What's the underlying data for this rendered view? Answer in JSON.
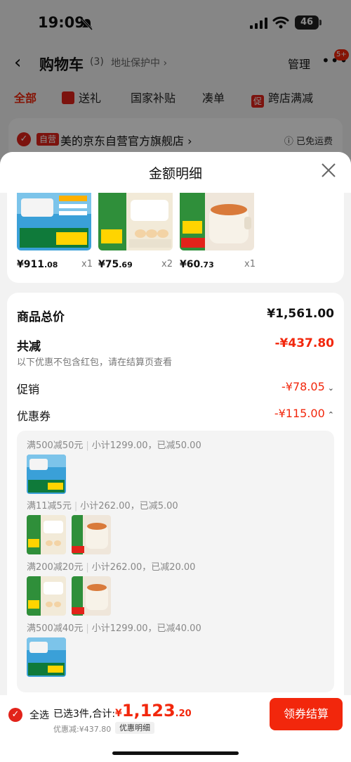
{
  "status_bar": {
    "time": "19:09",
    "battery": "46"
  },
  "nav": {
    "title": "购物车",
    "count": "(3)",
    "address_protect": "地址保护中 ›",
    "manage": "管理",
    "more_badge": "5+"
  },
  "tabs": [
    {
      "label": "全部"
    },
    {
      "label": "送礼"
    },
    {
      "label": "国家补贴"
    },
    {
      "label": "凑单"
    },
    {
      "label": "跨店满减",
      "badge": "促"
    }
  ],
  "store": {
    "tag": "自营",
    "name": "美的京东自营官方旗舰店 ›",
    "shipping": "已免运费"
  },
  "sheet": {
    "title": "金额明细",
    "goods": [
      {
        "price_int": "¥911",
        "price_dec": ".08",
        "qty": "x1"
      },
      {
        "price_int": "¥75",
        "price_dec": ".69",
        "qty": "x2"
      },
      {
        "price_int": "¥60",
        "price_dec": ".73",
        "qty": "x1"
      }
    ],
    "summary": {
      "total_label": "商品总价",
      "total_value": "¥1,561.00",
      "discount_label": "共减",
      "discount_value": "-¥437.80",
      "note": "以下优惠不包含红包，请在结算页查看",
      "promo_label": "促销",
      "promo_value": "-¥78.05",
      "coupon_label": "优惠券",
      "coupon_value": "-¥115.00"
    },
    "coupons": [
      {
        "rule": "满500减50元",
        "detail": "小计1299.00，已减50.00"
      },
      {
        "rule": "满11减5元",
        "detail": "小计262.00，已减5.00"
      },
      {
        "rule": "满200减20元",
        "detail": "小计262.00，已减20.00"
      },
      {
        "rule": "满500减40元",
        "detail": "小计1299.00，已减40.00"
      }
    ]
  },
  "bottom": {
    "select_all": "全选",
    "selected_info": "已选3件,合计:",
    "currency": "¥",
    "sum_int": "1,123",
    "sum_dec": ".20",
    "discount_info": "优惠减:¥437.80",
    "detail_button": "优惠明细",
    "checkout_button": "领券结算"
  },
  "colors": {
    "accent": "#f2270c",
    "brand_red": "#e2231a"
  }
}
